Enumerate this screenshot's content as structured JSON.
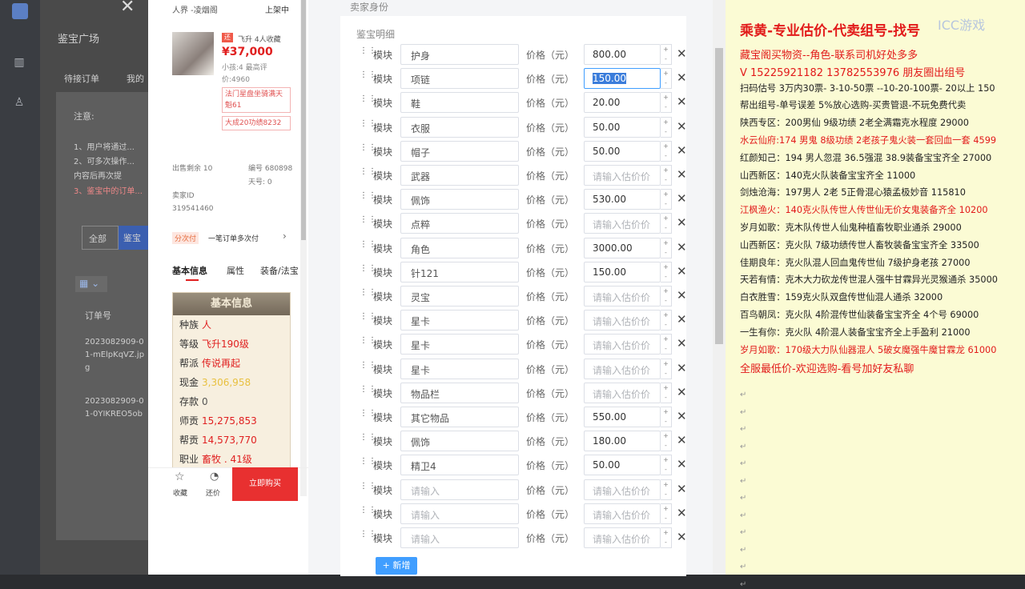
{
  "admin": {
    "title": "鉴宝广场",
    "tab_pending": "待接订单",
    "tab_mine": "我的",
    "notice_label": "注意:",
    "notice_lines": [
      "1、用户将通过...",
      "2、可多次操作...",
      "内容后再次提",
      "3、鉴宝中的订单..."
    ],
    "filter_all": "全部",
    "filter_jb": "鉴宝",
    "col_order": "订单号",
    "orders": [
      "2023082909-01-mElpKqVZ.jpg",
      "2023082909-01-0YIKREO5ob"
    ]
  },
  "phone": {
    "server": "人界 -凌烟阁",
    "status": "上架中",
    "seller_tag": "飞升 4人收藏",
    "price": "¥37,000",
    "sub": "小孩:4 最高评价:4960",
    "tags": [
      "法门星盘坐骑满天魁61",
      "大成20功绩8232"
    ],
    "stats": [
      "出售剩余 10",
      "编号 680898",
      "天号: 0",
      "卖家ID 319541460"
    ],
    "install": "分次付",
    "install_text": "一笔订单多次付",
    "tabs": [
      "基本信息",
      "属性",
      "装备/法宝"
    ],
    "panel_title": "基本信息",
    "info": [
      {
        "k": "种族",
        "v": "人"
      },
      {
        "k": "等级",
        "v": "飞升190级"
      },
      {
        "k": "帮派",
        "v": "传说再起"
      },
      {
        "k": "现金",
        "v": "3,306,958"
      },
      {
        "k": "存款",
        "v": "0"
      },
      {
        "k": "师贡",
        "v": "15,275,853"
      },
      {
        "k": "帮贡",
        "v": "14,573,770"
      },
      {
        "k": "职业",
        "v": "畜牧 . 41级"
      }
    ],
    "fav": "收藏",
    "bargain": "还价",
    "buy": "立即购买"
  },
  "form": {
    "header": "卖家身份",
    "section": "鉴宝明细",
    "module_label": "模块",
    "price_label": "价格（元）",
    "add_label": "新增",
    "rows": [
      {
        "name": "护身",
        "price": "800.00"
      },
      {
        "name": "项链",
        "price": "150.00",
        "selected": true
      },
      {
        "name": "鞋",
        "price": "20.00"
      },
      {
        "name": "衣服",
        "price": "50.00"
      },
      {
        "name": "帽子",
        "price": "50.00"
      },
      {
        "name": "武器",
        "price": ""
      },
      {
        "name": "佩饰",
        "price": "530.00"
      },
      {
        "name": "点粹",
        "price": ""
      },
      {
        "name": "角色",
        "price": "3000.00"
      },
      {
        "name": "针121",
        "price": "150.00"
      },
      {
        "name": "灵宝",
        "price": ""
      },
      {
        "name": "星卡",
        "price": ""
      },
      {
        "name": "星卡",
        "price": ""
      },
      {
        "name": "星卡",
        "price": ""
      },
      {
        "name": "物品栏",
        "price": ""
      },
      {
        "name": "其它物品",
        "price": "550.00"
      },
      {
        "name": "佩饰",
        "price": "180.00"
      },
      {
        "name": "精卫4",
        "price": "50.00"
      },
      {
        "name": "",
        "price": ""
      },
      {
        "name": "",
        "price": ""
      },
      {
        "name": "",
        "price": ""
      }
    ],
    "name_placeholder": "请输入",
    "price_placeholder": "请输入估价价"
  },
  "doc": {
    "title": "乘黄-专业估价-代卖组号-找号",
    "watermark": "ICC游戏",
    "lines": [
      {
        "t": "藏宝阁买物资--角色-联系司机好处多多",
        "c": "bigred"
      },
      {
        "t": "V 15225921182   13782553976 朋友圈出组号",
        "c": "bigred"
      },
      {
        "t": "扫码估号 3万内30票- 3-10-50票  --10-20-100票- 20以上 150",
        "c": ""
      },
      {
        "t": "帮出组号-单号误差 5%放心选购-买贵管退-不玩免费代卖",
        "c": ""
      },
      {
        "t": "陕西专区：200男仙 9级功绩 2老全满霜克水程度 29000",
        "c": ""
      },
      {
        "t": "水云仙府:174 男鬼 8级功绩 2老孩子鬼火装一套回血一套 4599",
        "c": "red"
      },
      {
        "t": "红颜知己：194 男人忽混 36.5强混 38.9装备宝宝齐全 27000",
        "c": ""
      },
      {
        "t": "山西新区：140克火队装备宝宝齐全 11000",
        "c": ""
      },
      {
        "t": "剑烛沧海：197男人 2老 5正骨混心猿孟极妙音 115810",
        "c": ""
      },
      {
        "t": "江枫渔火：140克火队传世人传世仙无价女鬼装备齐全 10200",
        "c": "red"
      },
      {
        "t": "岁月如歌：克木队传世人仙鬼种植畜牧职业通杀 29000",
        "c": ""
      },
      {
        "t": "山西新区：克火队 7级功绩传世人畜牧装备宝宝齐全 33500",
        "c": ""
      },
      {
        "t": "佳期良年：克火队混人回血鬼传世仙 7级护身老孩 27000",
        "c": ""
      },
      {
        "t": "天若有情：克木大力砍龙传世混人强牛甘霖异光灵猴通杀 35000",
        "c": ""
      },
      {
        "t": "白衣胜雪：159克火队双盘传世仙混人通杀 32000",
        "c": ""
      },
      {
        "t": "百鸟朝凤：克火队 4阶混传世仙装备宝宝齐全 4个号 69000",
        "c": ""
      },
      {
        "t": "一生有你：克火队 4阶混人装备宝宝齐全上手盈利 21000",
        "c": ""
      },
      {
        "t": "岁月如歌：170级大力队仙器混人 5破女魔强牛魔甘霖龙 61000",
        "c": "red"
      },
      {
        "t": "全服最低价-欢迎选购-看号加好友私聊",
        "c": "bigred"
      }
    ]
  }
}
